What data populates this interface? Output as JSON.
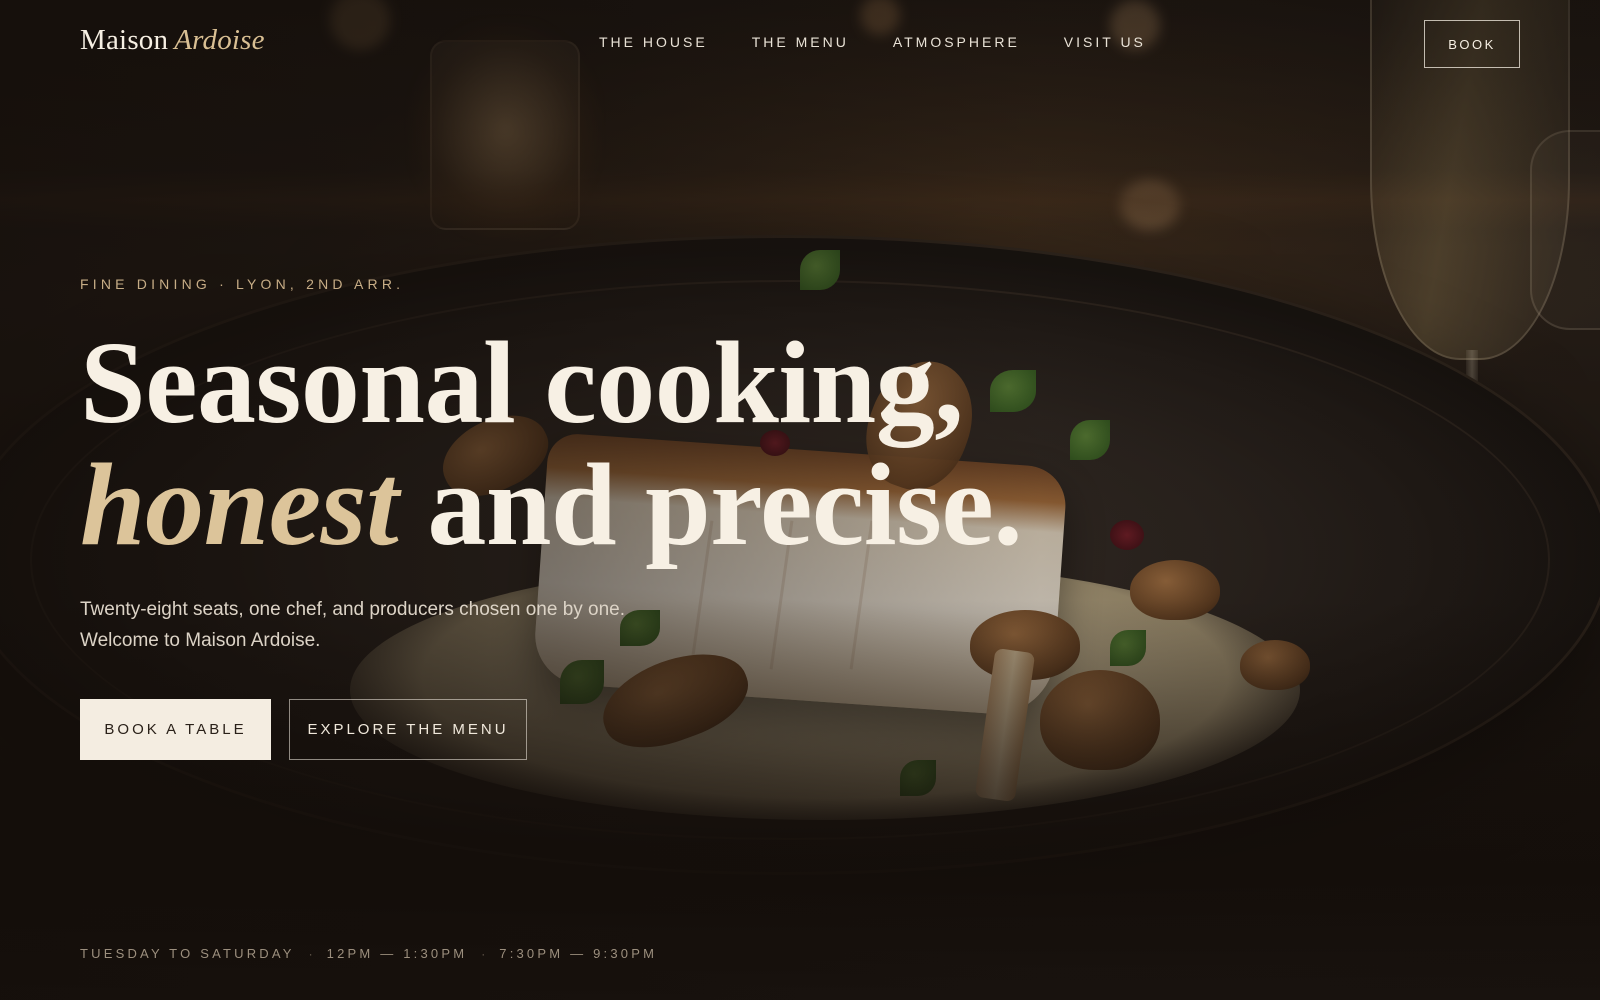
{
  "brand": {
    "name": "Maison",
    "accent": "Ardoise"
  },
  "nav": {
    "items": [
      {
        "label": "THE HOUSE"
      },
      {
        "label": "THE MENU"
      },
      {
        "label": "ATMOSPHERE"
      },
      {
        "label": "VISIT US"
      }
    ],
    "book_label": "BOOK"
  },
  "hero": {
    "eyebrow": "FINE DINING · LYON, 2ND ARR.",
    "headline_line1": "Seasonal cooking,",
    "headline_emphasis": "honest",
    "headline_line2_rest": " and precise.",
    "subtitle_line1": "Twenty-eight seats, one chef, and producers chosen one by one.",
    "subtitle_line2": "Welcome to Maison Ardoise.",
    "primary_cta": "BOOK A TABLE",
    "secondary_cta": "EXPLORE THE MENU"
  },
  "hours": {
    "days": "TUESDAY TO SATURDAY",
    "lunch": "12PM — 1:30PM",
    "dinner": "7:30PM — 9:30PM",
    "separator": "·"
  },
  "colors": {
    "background": "#1a1410",
    "accent_gold": "#dcc49a",
    "cream": "#f4ede1"
  }
}
